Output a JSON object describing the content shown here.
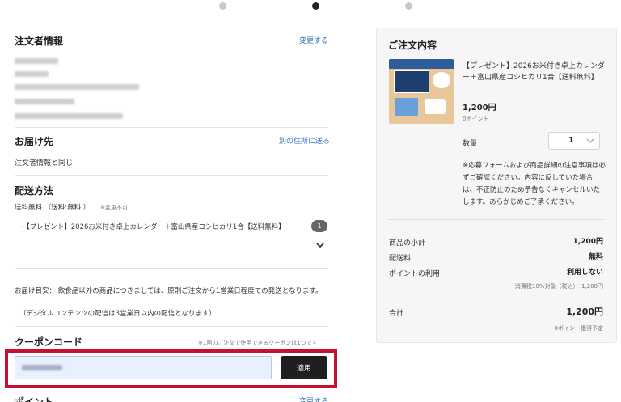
{
  "customer": {
    "title": "注文者情報",
    "change_link": "変更する"
  },
  "delivery": {
    "title": "お届け先",
    "alt_address_link": "別の住所に送る",
    "same_as_customer": "注文者情報と同じ"
  },
  "shipping": {
    "title": "配送方法",
    "method": "送料無料 （送料:無料 ）",
    "not_changeable": "※変更不可",
    "item_line": "・【プレゼント】2026お米付き卓上カレンダー＋富山県産コシヒカリ1合【送料無料】",
    "item_count": "1"
  },
  "delivery_note": {
    "line1": "お届け目安： 飲食品以外の商品につきましては、原則ご注文から1営業日程度での発送となります。",
    "line2": "（デジタルコンテンツの配信は3営業日以内の配信となります）"
  },
  "coupon": {
    "title": "クーポンコード",
    "note": "※1回のご注文で使用できるクーポンは1つです",
    "apply_label": "適用"
  },
  "points": {
    "title": "ポイント",
    "change_link": "変更する"
  },
  "order": {
    "title": "ご注文内容",
    "product_name": "【プレゼント】2026お米付き卓上カレンダー＋富山県産コシヒカリ1合【送料無料】",
    "price": "1,200円",
    "points": "0ポイント",
    "quantity_label": "数量",
    "quantity": "1",
    "notice": "※応募フォームおよび商品詳細の注意事項は必ずご確認ください。内容に反していた場合は、不正防止のため予告なくキャンセルいたします。あらかじめご了承ください。",
    "subtotal_label": "商品の小計",
    "subtotal_value": "1,200円",
    "shipping_label": "配送料",
    "shipping_value": "無料",
    "points_use_label": "ポイントの利用",
    "points_use_value": "利用しない",
    "tax_note": "消費税10%対象（税込）：1,200円",
    "total_label": "合計",
    "total_value": "1,200円",
    "earn_points": "0ポイント獲得予定"
  },
  "colors": {
    "link": "#2f6fb6",
    "highlight": "#c6122f",
    "button": "#1f1f1f",
    "input_bg": "#e9f0fd"
  }
}
